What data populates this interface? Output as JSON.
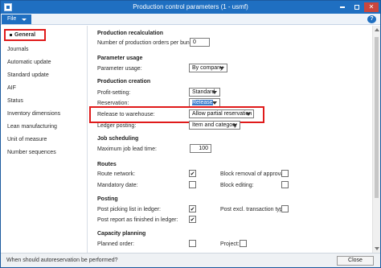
{
  "window": {
    "title": "Production control parameters (1 - usmf)",
    "app_icon": "window-icon",
    "buttons": [
      "minimize-icon",
      "maximize-icon",
      "close-icon"
    ]
  },
  "ribbon": {
    "file_label": "File",
    "help_icon": "?"
  },
  "sidebar": {
    "items": [
      {
        "label": "General",
        "selected": true
      },
      {
        "label": "Journals"
      },
      {
        "label": "Automatic update"
      },
      {
        "label": "Standard update"
      },
      {
        "label": "AIF"
      },
      {
        "label": "Status"
      },
      {
        "label": "Inventory dimensions"
      },
      {
        "label": "Lean manufacturing"
      },
      {
        "label": "Unit of measure"
      },
      {
        "label": "Number sequences"
      }
    ]
  },
  "sections": {
    "production_recalculation": {
      "title": "Production recalculation",
      "orders_label": "Number of production orders per bundle:",
      "orders_value": "0"
    },
    "parameter_usage": {
      "title": "Parameter usage",
      "label": "Parameter usage:",
      "value": "By company"
    },
    "production_creation": {
      "title": "Production creation",
      "profit_label": "Profit-setting:",
      "profit_value": "Standard",
      "reservation_label": "Reservation:",
      "reservation_value": "Release",
      "release_label": "Release to warehouse:",
      "release_value": "Allow partial reservation",
      "ledger_label": "Ledger posting:",
      "ledger_value": "Item and category"
    },
    "job_scheduling": {
      "title": "Job scheduling",
      "lead_label": "Maximum job lead time:",
      "lead_value": "100"
    },
    "routes": {
      "title": "Routes",
      "route_network": "Route network:",
      "mandatory_date": "Mandatory date:",
      "block_removal": "Block removal of approval:",
      "block_editing": "Block editing:"
    },
    "posting": {
      "title": "Posting",
      "post_picking": "Post picking list in ledger:",
      "post_report": "Post report as finished in ledger:",
      "post_excl": "Post excl. transaction type:"
    },
    "capacity_planning": {
      "title": "Capacity planning",
      "planned_order": "Planned order:",
      "project": "Project:"
    }
  },
  "status": {
    "text": "When should autoreservation be performed?",
    "close_label": "Close"
  }
}
